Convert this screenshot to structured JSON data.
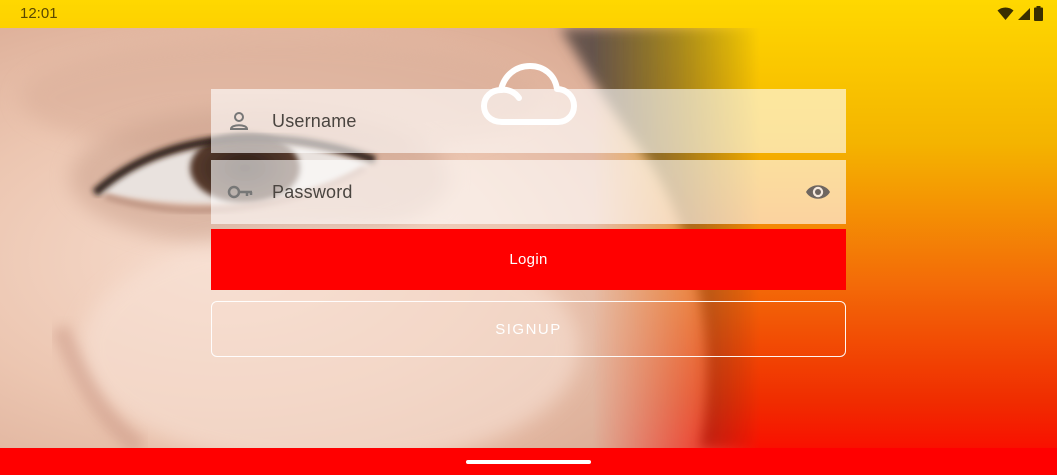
{
  "status_bar": {
    "time": "12:01",
    "icons": [
      "wifi-icon",
      "cell-signal-icon",
      "battery-icon"
    ]
  },
  "logo": {
    "icon": "cloud-icon"
  },
  "form": {
    "username": {
      "placeholder": "Username",
      "icon": "person-icon"
    },
    "password": {
      "placeholder": "Password",
      "icon": "key-icon",
      "toggle_icon": "eye-icon"
    },
    "login_label": "Login",
    "signup_label": "SIGNUP"
  },
  "colors": {
    "background_top": "#ffd800",
    "background_bottom": "#ff0000",
    "login_button": "#ff0000",
    "field_background": "rgba(255,255,255,0.62)"
  }
}
